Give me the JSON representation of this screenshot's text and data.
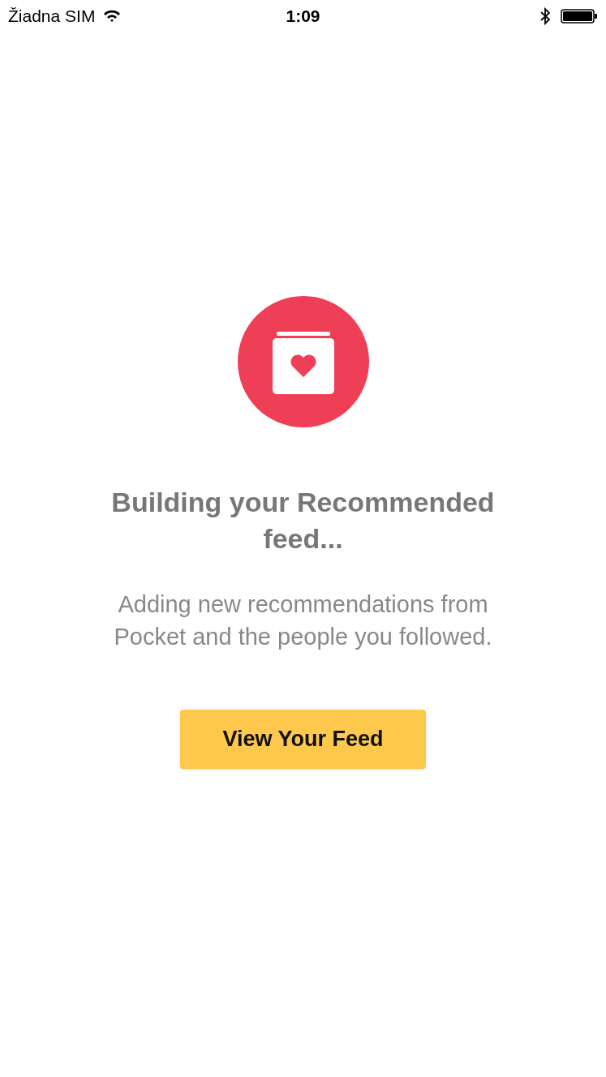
{
  "status_bar": {
    "carrier": "Žiadna SIM",
    "time": "1:09"
  },
  "empty_state": {
    "title": "Building your Recommended feed...",
    "message": "Adding new recommendations from Pocket and the people you followed.",
    "button": "View Your Feed"
  }
}
